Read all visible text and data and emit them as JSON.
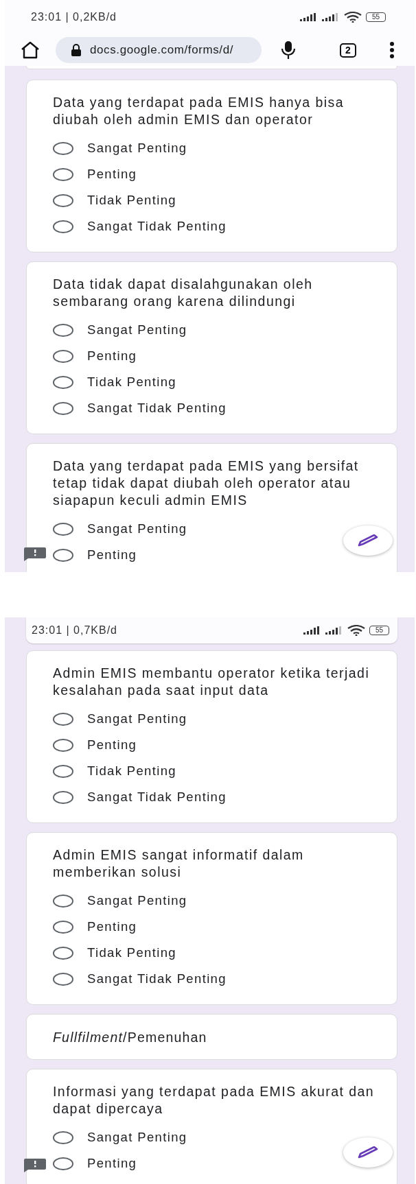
{
  "screens": [
    {
      "status_bar": {
        "text": "23:01 | 0,2KB/d",
        "battery": "55"
      },
      "browser_bar": {
        "url": "docs.google.com/forms/d/",
        "tab_count": "2"
      },
      "cards": [
        {
          "kind": "question",
          "title": "Data yang terdapat pada EMIS hanya bisa diubah oleh admin EMIS dan operator",
          "options": [
            {
              "label": "Sangat Penting",
              "selected": false
            },
            {
              "label": "Penting",
              "selected": false
            },
            {
              "label": "Tidak Penting",
              "selected": false
            },
            {
              "label": "Sangat Tidak Penting",
              "selected": false
            }
          ]
        },
        {
          "kind": "question",
          "title": "Data tidak dapat disalahgunakan oleh sembarang orang karena dilindungi",
          "options": [
            {
              "label": "Sangat Penting",
              "selected": false
            },
            {
              "label": "Penting",
              "selected": false
            },
            {
              "label": "Tidak Penting",
              "selected": false
            },
            {
              "label": "Sangat Tidak Penting",
              "selected": false
            }
          ]
        },
        {
          "kind": "question",
          "title": "Data yang terdapat pada EMIS yang bersifat tetap tidak dapat diubah oleh operator atau siapapun keculi admin EMIS",
          "options": [
            {
              "label": "Sangat Penting",
              "selected": false
            },
            {
              "label": "Penting",
              "selected": false
            }
          ]
        }
      ]
    },
    {
      "status_bar": {
        "text": "23:01 | 0,7KB/d",
        "battery": "55"
      },
      "cards": [
        {
          "kind": "question",
          "title": "Admin EMIS membantu operator ketika terjadi kesalahan pada saat input data",
          "options": [
            {
              "label": "Sangat Penting",
              "selected": false
            },
            {
              "label": "Penting",
              "selected": false
            },
            {
              "label": "Tidak Penting",
              "selected": false
            },
            {
              "label": "Sangat Tidak Penting",
              "selected": false
            }
          ]
        },
        {
          "kind": "question",
          "title": "Admin EMIS sangat informatif dalam memberikan solusi",
          "options": [
            {
              "label": "Sangat Penting",
              "selected": false
            },
            {
              "label": "Penting",
              "selected": false
            },
            {
              "label": "Tidak Penting",
              "selected": false
            },
            {
              "label": "Sangat Tidak Penting",
              "selected": false
            }
          ]
        },
        {
          "kind": "section",
          "title": "*Fullfilment*/Pemenuhan"
        },
        {
          "kind": "question",
          "title": "Informasi yang terdapat pada EMIS akurat dan dapat dipercaya",
          "options": [
            {
              "label": "Sangat Penting",
              "selected": false
            },
            {
              "label": "Penting",
              "selected": false
            }
          ]
        }
      ]
    }
  ]
}
